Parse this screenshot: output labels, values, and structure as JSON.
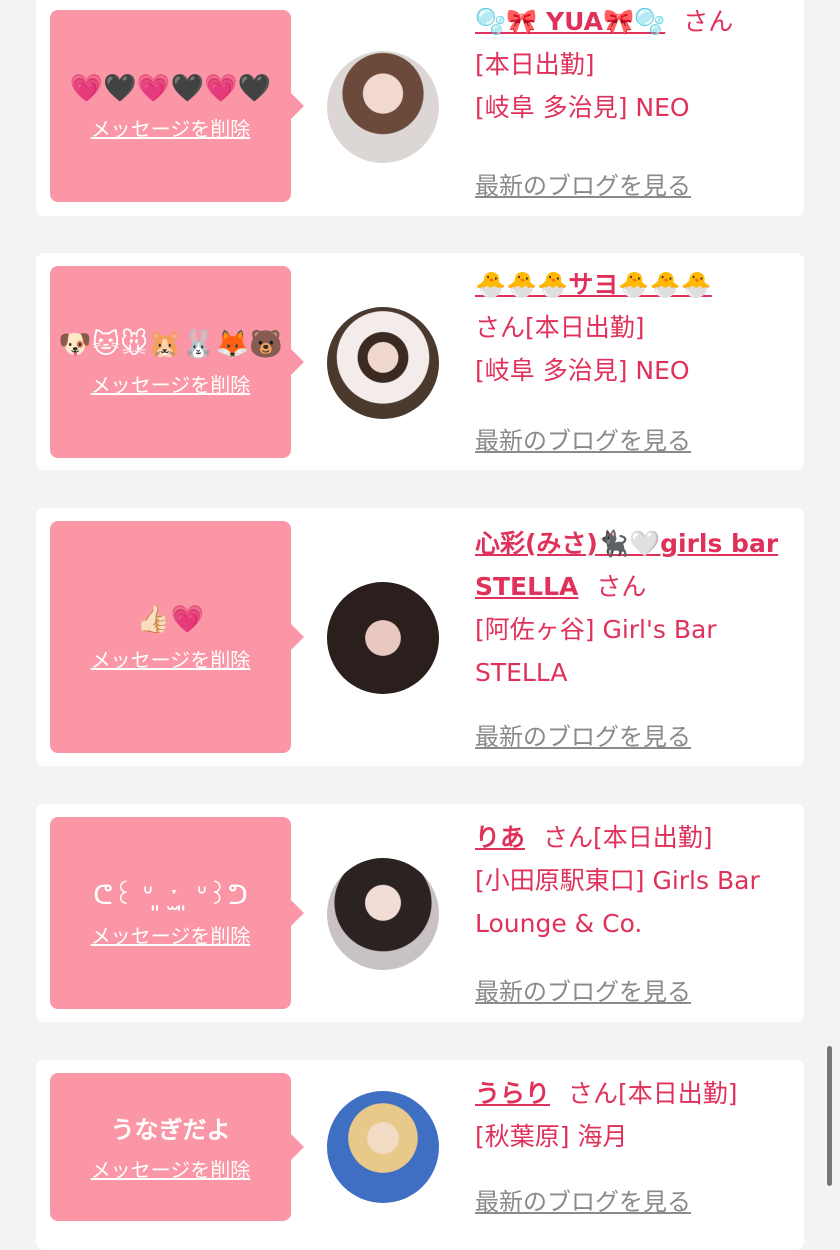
{
  "accent": "#e0315a",
  "bubble_color": "#fa96a5",
  "delete_label": "メッセージを削除",
  "blog_label": "最新のブログを見る",
  "san_suffix": "さん",
  "cards": [
    {
      "message": "💗🖤💗🖤💗🖤",
      "name": "🫧🎀 YUA🎀🫧",
      "lines": [
        "[本日出勤]",
        "[岐阜 多治見] NEO"
      ]
    },
    {
      "message": "🐶🐱🐭🐹🐰🦊🐻",
      "name": "🐣🐣🐣サヨ🐣🐣🐣",
      "lines": [
        "さん[本日出勤]",
        "[岐阜 多治見] NEO"
      ]
    },
    {
      "message": "👍🏻💗",
      "name": "心彩(みさ)🐈‍⬛🤍girls bar STELLA",
      "lines": [
        "[阿佐ヶ谷] Girl's Bar STELLA"
      ]
    },
    {
      "message": "ᕦ꒰ ᐡ ͈ ˑ̫ ͈ ᐡ꒱ᕤ",
      "name": "りあ",
      "lines": [
        "さん[本日出勤]",
        "[小田原駅東口] Girls Bar Lounge & Co."
      ]
    },
    {
      "message": "うなぎだよ",
      "name": "うらり",
      "lines": [
        "さん[本日出勤]",
        "[秋葉原] 海月"
      ]
    }
  ]
}
